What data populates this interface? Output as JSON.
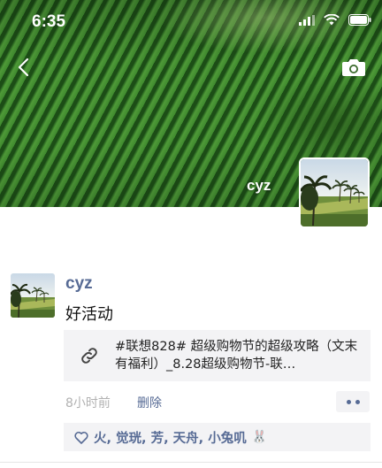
{
  "status_bar": {
    "time": "6:35",
    "icons": [
      "signal-icon",
      "wifi-icon",
      "battery-icon"
    ]
  },
  "header": {
    "back_icon": "chevron-left-icon",
    "camera_icon": "camera-icon"
  },
  "profile": {
    "name": "cyz",
    "avatar": "palm-trees-landscape"
  },
  "post": {
    "username": "cyz",
    "text": "好活动",
    "link": {
      "icon": "link-icon",
      "title": "#联想828# 超级购物节的超级攻略（文末有福利）_8.28超级购物节-联…"
    },
    "time": "8小时前",
    "delete_label": "删除",
    "more_icon": "more-dots-icon",
    "likes": {
      "icon": "heart-icon",
      "names": "火, 觉珖, 芳, 天舟, 小兔叽",
      "emoji": "🐰"
    }
  },
  "colors": {
    "link_blue": "#576b95",
    "card_bg": "#f3f3f5",
    "muted_text": "#b2b2b2"
  }
}
